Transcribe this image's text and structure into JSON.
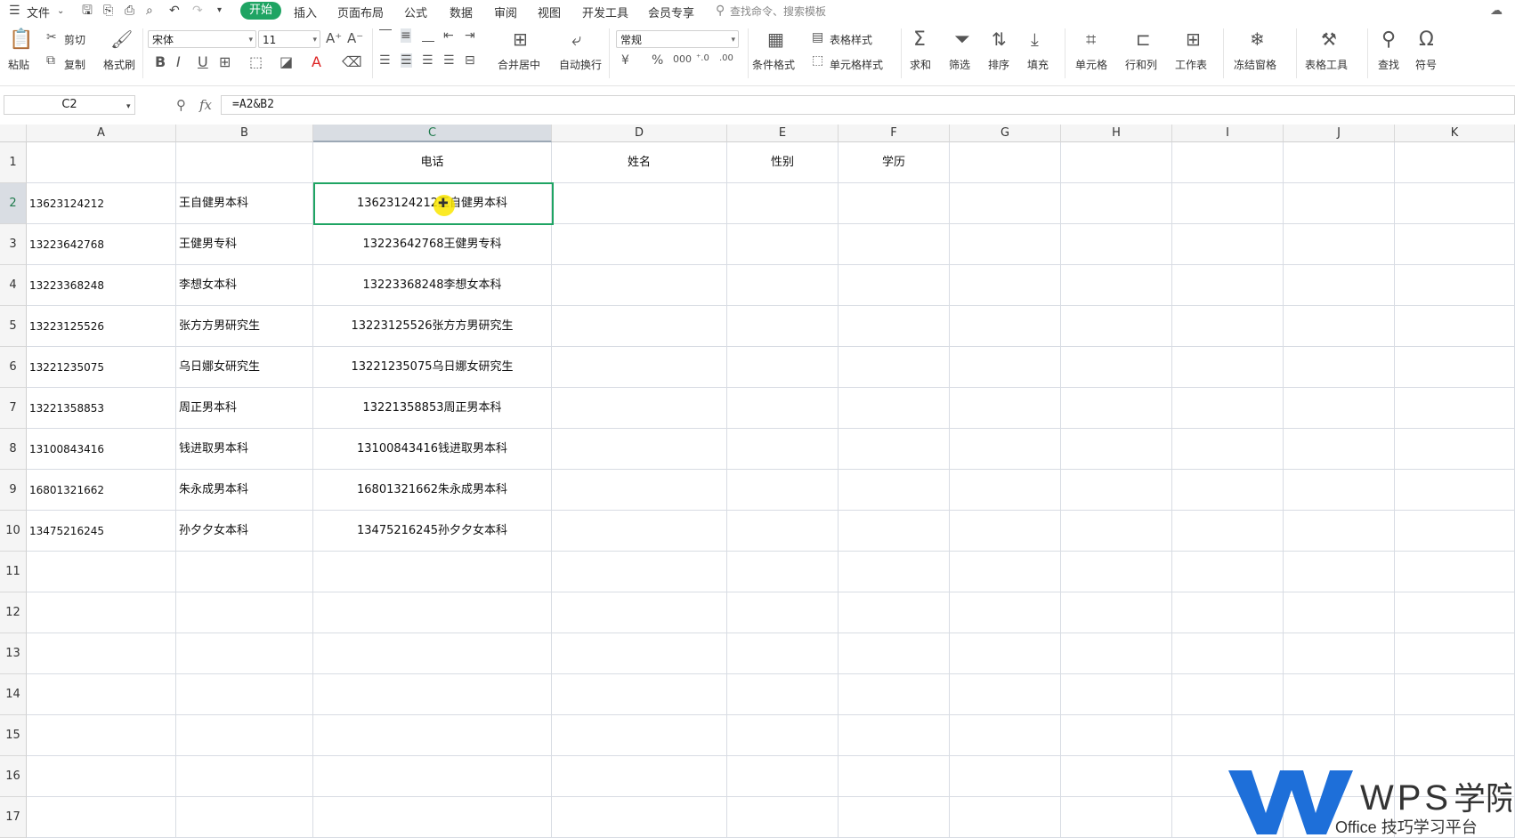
{
  "menubar": {
    "menu": "文件",
    "tabs": [
      "开始",
      "插入",
      "页面布局",
      "公式",
      "数据",
      "审阅",
      "视图",
      "开发工具",
      "会员专享"
    ],
    "active_tab": "开始",
    "search_placeholder": "查找命令、搜索模板"
  },
  "ribbon": {
    "paste": "粘贴",
    "cut": "剪切",
    "copy": "复制",
    "format_painter": "格式刷",
    "font_name": "宋体",
    "font_size": "11",
    "merge_center": "合并居中",
    "wrap_text": "自动换行",
    "number_format": "常规",
    "conditional_format": "条件格式",
    "table_style": "表格样式",
    "cell_style": "单元格样式",
    "sum": "求和",
    "filter": "筛选",
    "sort": "排序",
    "fill": "填充",
    "cell": "单元格",
    "row_col": "行和列",
    "worksheet": "工作表",
    "freeze": "冻结窗格",
    "table_tools": "表格工具",
    "find": "查找",
    "symbol": "符号"
  },
  "formula_bar": {
    "name_box": "C2",
    "fx": "fx",
    "formula": "=A2&B2"
  },
  "columns": [
    "A",
    "B",
    "C",
    "D",
    "E",
    "F",
    "G",
    "H",
    "I",
    "J",
    "K"
  ],
  "selected_column": "C",
  "rows": [
    {
      "n": "1",
      "a": "",
      "b": "",
      "c": "电话",
      "d": "姓名",
      "e": "性别",
      "f": "学历"
    },
    {
      "n": "2",
      "a": "13623124212",
      "b": "王自健男本科",
      "c": "13623124212王自健男本科",
      "d": "",
      "e": "",
      "f": ""
    },
    {
      "n": "3",
      "a": "13223642768",
      "b": "王健男专科",
      "c": "13223642768王健男专科",
      "d": "",
      "e": "",
      "f": ""
    },
    {
      "n": "4",
      "a": "13223368248",
      "b": "李想女本科",
      "c": "13223368248李想女本科",
      "d": "",
      "e": "",
      "f": ""
    },
    {
      "n": "5",
      "a": "13223125526",
      "b": "张方方男研究生",
      "c": "13223125526张方方男研究生",
      "d": "",
      "e": "",
      "f": ""
    },
    {
      "n": "6",
      "a": "13221235075",
      "b": "乌日娜女研究生",
      "c": "13221235075乌日娜女研究生",
      "d": "",
      "e": "",
      "f": ""
    },
    {
      "n": "7",
      "a": "13221358853",
      "b": "周正男本科",
      "c": "13221358853周正男本科",
      "d": "",
      "e": "",
      "f": ""
    },
    {
      "n": "8",
      "a": "13100843416",
      "b": "钱进取男本科",
      "c": "13100843416钱进取男本科",
      "d": "",
      "e": "",
      "f": ""
    },
    {
      "n": "9",
      "a": "16801321662",
      "b": "朱永成男本科",
      "c": "16801321662朱永成男本科",
      "d": "",
      "e": "",
      "f": ""
    },
    {
      "n": "10",
      "a": "13475216245",
      "b": "孙夕夕女本科",
      "c": "13475216245孙夕夕女本科",
      "d": "",
      "e": "",
      "f": ""
    },
    {
      "n": "11",
      "a": "",
      "b": "",
      "c": "",
      "d": "",
      "e": "",
      "f": ""
    },
    {
      "n": "12",
      "a": "",
      "b": "",
      "c": "",
      "d": "",
      "e": "",
      "f": ""
    },
    {
      "n": "13",
      "a": "",
      "b": "",
      "c": "",
      "d": "",
      "e": "",
      "f": ""
    },
    {
      "n": "14",
      "a": "",
      "b": "",
      "c": "",
      "d": "",
      "e": "",
      "f": ""
    },
    {
      "n": "15",
      "a": "",
      "b": "",
      "c": "",
      "d": "",
      "e": "",
      "f": ""
    },
    {
      "n": "16",
      "a": "",
      "b": "",
      "c": "",
      "d": "",
      "e": "",
      "f": ""
    },
    {
      "n": "17",
      "a": "",
      "b": "",
      "c": "",
      "d": "",
      "e": "",
      "f": ""
    }
  ],
  "watermark": {
    "brand": "WPS学院",
    "tagline": "Office 技巧学习平台"
  },
  "colors": {
    "accent": "#1fa463",
    "selection_header": "#d9dde3",
    "logo": "#1e6fd9"
  }
}
